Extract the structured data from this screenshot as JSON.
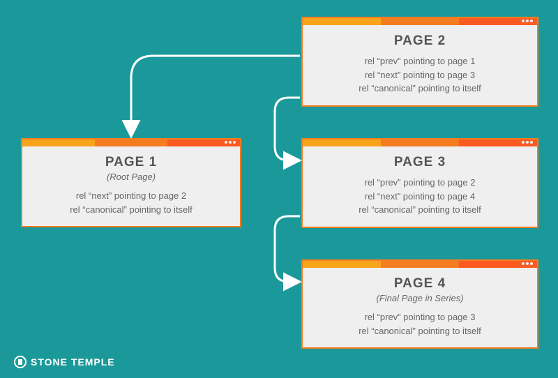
{
  "brand": {
    "name": "STONE TEMPLE"
  },
  "colors": {
    "background": "#1b999a",
    "window_bg": "#efefef",
    "accent1": "#f9a41b",
    "accent2": "#f57c1f",
    "accent3": "#fb5a20",
    "text": "#555555"
  },
  "pages": {
    "p1": {
      "title": "PAGE 1",
      "subtitle": "(Root Page)",
      "lines": [
        "rel “next” pointing to page 2",
        "rel “canonical” pointing to itself"
      ]
    },
    "p2": {
      "title": "PAGE 2",
      "subtitle": "",
      "lines": [
        "rel “prev” pointing to page 1",
        "rel “next” pointing to page 3",
        "rel “canonical” pointing to itself"
      ]
    },
    "p3": {
      "title": "PAGE 3",
      "subtitle": "",
      "lines": [
        "rel “prev” pointing to page 2",
        "rel “next” pointing to page 4",
        "rel “canonical” pointing to itself"
      ]
    },
    "p4": {
      "title": "PAGE 4",
      "subtitle": "(Final Page in Series)",
      "lines": [
        "rel “prev” pointing to page 3",
        "rel “canonical” pointing to itself"
      ]
    }
  }
}
